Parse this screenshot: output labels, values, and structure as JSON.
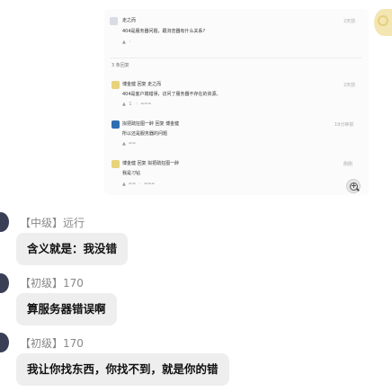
{
  "thread": {
    "top_comment": {
      "author": "走之而",
      "text": "404是服务器问题，跟浏览器有什么关系?",
      "time": "2天前"
    },
    "reply_count_label": "3 条回复",
    "replies": [
      {
        "author_line": "博金健 回复 走之而",
        "text": "404是客户端错误，访问了服务器不存在的资源。",
        "time": "2天前"
      },
      {
        "author_line": "拟把疏狂图一醉 回复 博金健",
        "text": "所以还是服务器的问题",
        "time": "19分钟前"
      },
      {
        "author_line": "博金健 回复 拟把疏狂图一醉",
        "text": "我是刁钻",
        "time": "刚刚"
      }
    ]
  },
  "chat": {
    "messages": [
      {
        "sender": "【中级】远行",
        "text": "含义就是：我没错"
      },
      {
        "sender": "【初级】170",
        "text": "算服务器错误啊"
      },
      {
        "sender": "【初级】170",
        "text": "我让你找东西，你找不到，就是你的错"
      }
    ]
  },
  "icons": {
    "zoom": "zoom-in-icon",
    "avatar_right": "avatar-icon"
  },
  "colors": {
    "bubble_bg": "#eeeeee",
    "sender_text": "#888888",
    "thread_bg": "#fbfbfb"
  }
}
